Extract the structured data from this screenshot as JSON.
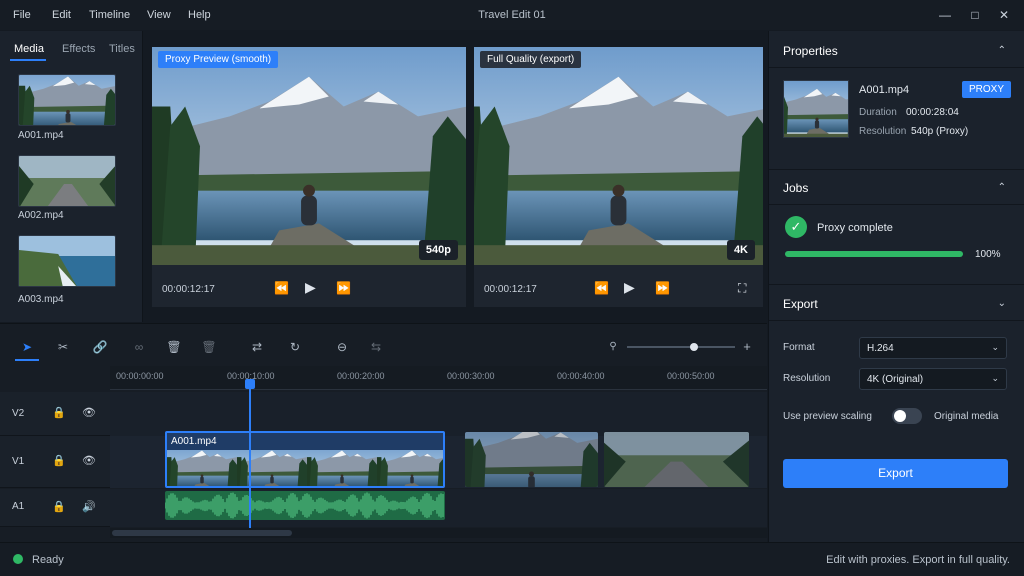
{
  "titlebar": {
    "menus": [
      "File",
      "Edit",
      "Timeline",
      "View",
      "Help"
    ],
    "title": "Travel Edit 01"
  },
  "media": {
    "tabs": [
      "Media",
      "Effects",
      "Titles"
    ],
    "items": [
      "A001.mp4",
      "A002.mp4",
      "A003.mp4"
    ]
  },
  "preview_proxy": {
    "badge": "Proxy Preview (smooth)",
    "resolution": "540p",
    "timecode": "00:00:12:17"
  },
  "preview_full": {
    "badge": "Full Quality (export)",
    "resolution": "4K",
    "timecode": "00:00:12:17"
  },
  "properties": {
    "title": "Properties",
    "clip_name": "A001.mp4",
    "proxy_badge": "PROXY",
    "duration_label": "Duration",
    "duration_value": "00:00:28:04",
    "resolution_label": "Resolution",
    "resolution_value": "540p (Proxy)"
  },
  "jobs": {
    "title": "Jobs",
    "job_label": "Proxy complete",
    "progress": 1.0,
    "progress_text": "100%"
  },
  "export": {
    "title": "Export",
    "format_label": "Format",
    "format_value": "H.264",
    "resolution_label": "Resolution",
    "resolution_value": "4K (Original)",
    "scaling_label": "Use preview scaling",
    "scaling_on": false,
    "original_label": "Original media",
    "button": "Export"
  },
  "timeline": {
    "ticks": [
      "00:00:00:00",
      "00:00:10:00",
      "00:00:20:00",
      "00:00:30:00",
      "00:00:40:00",
      "00:00:50:00"
    ],
    "tracks": [
      "V2",
      "V1",
      "A1"
    ],
    "clip_label": "A001.mp4",
    "zoom": 0.5
  },
  "status": {
    "left": "Ready",
    "right": "Edit with proxies. Export in full quality."
  },
  "colors": {
    "accent": "#2d7ff9",
    "success": "#2fb865",
    "audio": "#2a9a5e"
  }
}
